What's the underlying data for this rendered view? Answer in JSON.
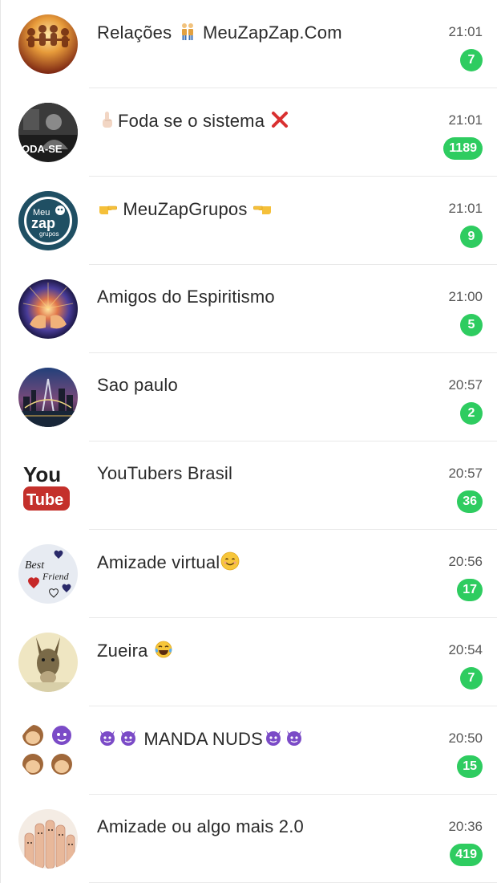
{
  "chats": [
    {
      "name_prefix": "",
      "name": "Relações",
      "name_suffix": "MeuZapZap.Com",
      "time": "21:01",
      "unread": "7",
      "avatar_icon": "people-silhouettes-avatar",
      "emoji_before": "",
      "emoji_after": "couple-emoji"
    },
    {
      "name_prefix": "",
      "name": "Foda se o sistema",
      "name_suffix": "",
      "time": "21:01",
      "unread": "1189",
      "avatar_icon": "person-photo-avatar",
      "avatar_text": "ODA-SE",
      "emoji_before": "raised-finger-emoji",
      "emoji_after": "cross-mark-emoji"
    },
    {
      "name_prefix": "",
      "name": "MeuZapGrupos",
      "name_suffix": "",
      "time": "21:01",
      "unread": "9",
      "avatar_icon": "meuzap-logo-avatar",
      "avatar_text_1": "Meu",
      "avatar_text_2": "zap",
      "avatar_text_3": "grupos",
      "emoji_before": "pointing-right-emoji",
      "emoji_after": "pointing-left-emoji"
    },
    {
      "name_prefix": "",
      "name": "Amigos do Espiritismo",
      "name_suffix": "",
      "time": "21:00",
      "unread": "5",
      "avatar_icon": "glowing-hands-avatar",
      "emoji_before": "",
      "emoji_after": ""
    },
    {
      "name_prefix": "",
      "name": "Sao paulo",
      "name_suffix": "",
      "time": "20:57",
      "unread": "2",
      "avatar_icon": "city-night-avatar",
      "emoji_before": "",
      "emoji_after": ""
    },
    {
      "name_prefix": "",
      "name": "YouTubers Brasil",
      "name_suffix": "",
      "time": "20:57",
      "unread": "36",
      "avatar_icon": "youtube-logo-avatar",
      "avatar_text_1": "You",
      "avatar_text_2": "Tube",
      "emoji_before": "",
      "emoji_after": ""
    },
    {
      "name_prefix": "",
      "name": "Amizade virtual",
      "name_suffix": "",
      "time": "20:56",
      "unread": "17",
      "avatar_icon": "best-friend-avatar",
      "avatar_text_1": "Best",
      "avatar_text_2": "Friend",
      "emoji_before": "",
      "emoji_after": "smiling-face-emoji"
    },
    {
      "name_prefix": "",
      "name": "Zueira",
      "name_suffix": "",
      "time": "20:54",
      "unread": "7",
      "avatar_icon": "donkey-avatar",
      "emoji_before": "",
      "emoji_after": "tears-of-joy-emoji"
    },
    {
      "name_prefix": "",
      "name": "MANDA NUDS",
      "name_suffix": "",
      "time": "20:50",
      "unread": "15",
      "avatar_icon": "monkeys-devils-avatar",
      "emoji_before": "two-devil-emoji",
      "emoji_after": "two-devil-emoji"
    },
    {
      "name_prefix": "",
      "name": "Amizade ou algo mais 2.0",
      "name_suffix": "",
      "time": "20:36",
      "unread": "419",
      "avatar_icon": "finger-faces-avatar",
      "emoji_before": "",
      "emoji_after": ""
    }
  ],
  "colors": {
    "badge": "#2ecc60",
    "name_text": "#2b2b2b",
    "time_text": "#555555",
    "divider": "#e9e9e9"
  }
}
